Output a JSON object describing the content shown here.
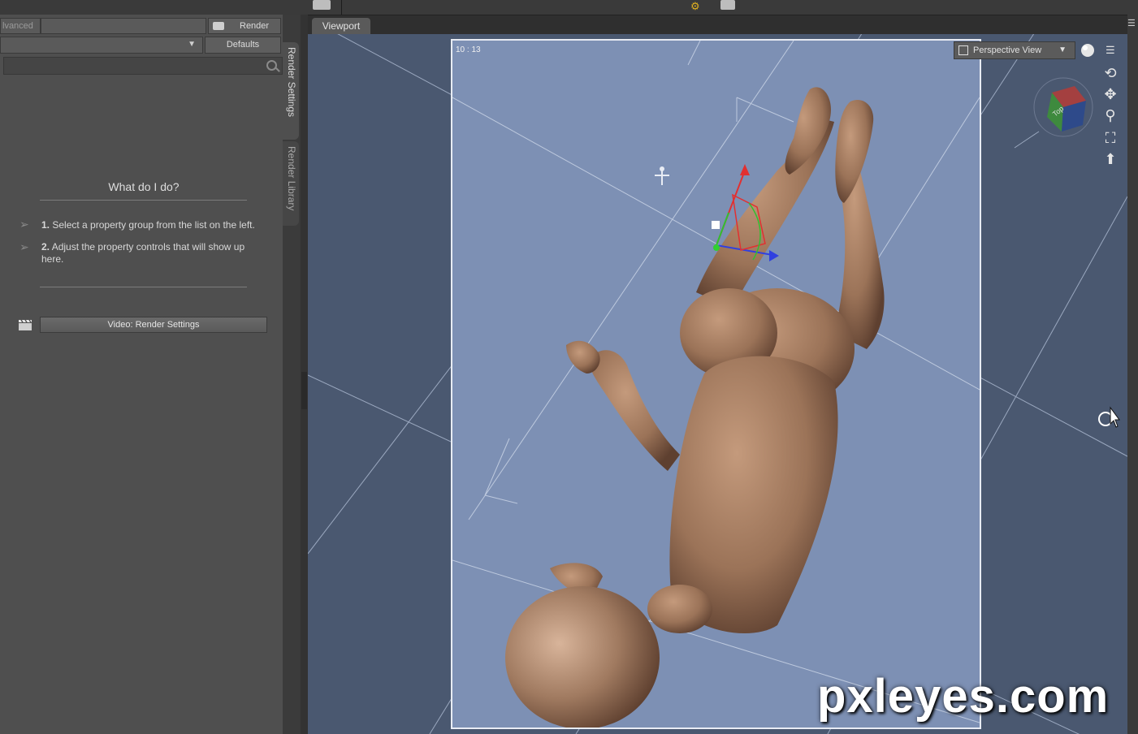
{
  "toolbar": {
    "render_label": "Render",
    "defaults_label": "Defaults",
    "advanced_tab": "lvanced"
  },
  "side_tabs": [
    {
      "label": "Render Settings"
    },
    {
      "label": "Render Library"
    }
  ],
  "help": {
    "title": "What do I do?",
    "steps": [
      {
        "num": "1.",
        "text": "Select a property group from the list on the left."
      },
      {
        "num": "2.",
        "text": "Adjust the property controls that will show up here."
      }
    ],
    "video_button": "Video: Render Settings"
  },
  "viewport": {
    "tab_label": "Viewport",
    "fps": "10 : 13",
    "view_select": "Perspective View"
  },
  "watermark": "pxleyes.com",
  "colors": {
    "panel_bg": "#4f4f4f",
    "viewport_bg": "#4a5870",
    "camera_frame_bg": "#7d90b4",
    "skin": "#9b7358"
  },
  "icons": [
    "camera-icon",
    "search-icon",
    "menu-icon",
    "clapperboard-icon",
    "orbit-icon",
    "pan-icon",
    "zoom-icon",
    "frame-icon",
    "reset-icon",
    "view-cube-icon",
    "render-sphere-icon"
  ]
}
